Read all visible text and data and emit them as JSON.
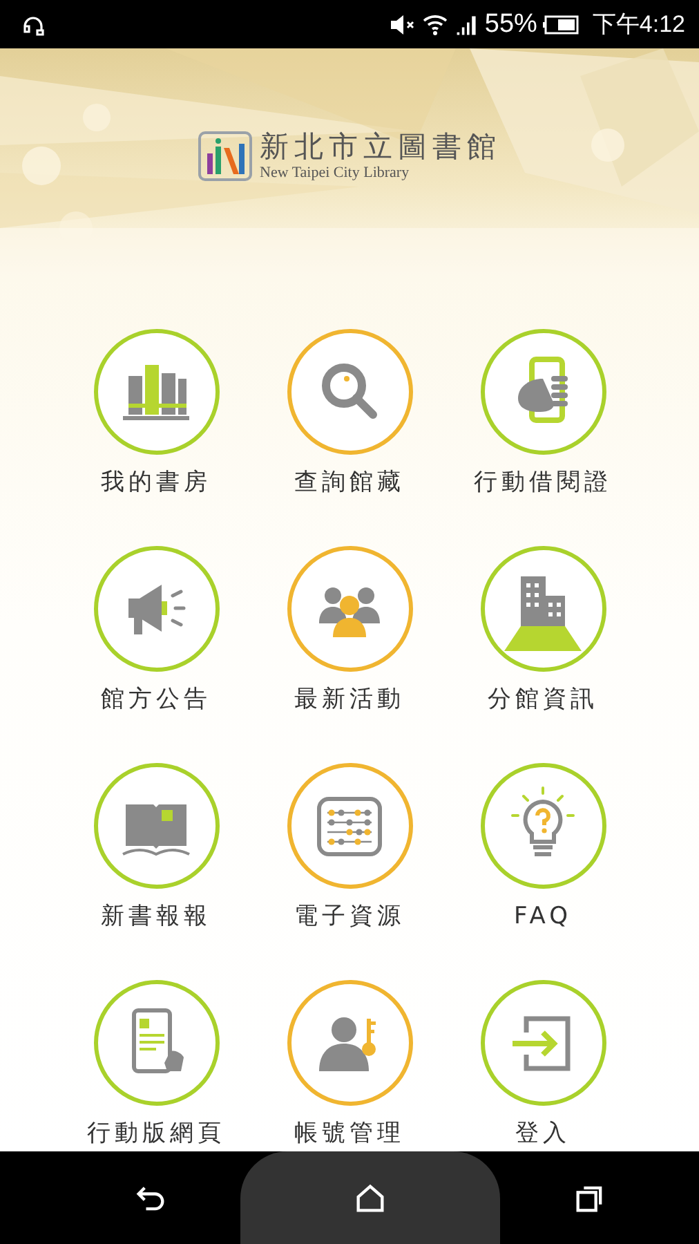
{
  "status_bar": {
    "battery": "55%",
    "time": "下午4:12"
  },
  "header": {
    "title": "新北市立圖書館",
    "subtitle": "New Taipei City Library"
  },
  "menu": [
    {
      "label": "我的書房",
      "kind": "books",
      "color": "#a9d12b"
    },
    {
      "label": "查詢館藏",
      "kind": "search",
      "color": "#f0b530"
    },
    {
      "label": "行動借閱證",
      "kind": "phone",
      "color": "#a9d12b"
    },
    {
      "label": "館方公告",
      "kind": "megaphone",
      "color": "#a9d12b"
    },
    {
      "label": "最新活動",
      "kind": "people",
      "color": "#f0b530"
    },
    {
      "label": "分館資訊",
      "kind": "building",
      "color": "#a9d12b"
    },
    {
      "label": "新書報報",
      "kind": "book",
      "color": "#a9d12b"
    },
    {
      "label": "電子資源",
      "kind": "abacus",
      "color": "#f0b530"
    },
    {
      "label": "FAQ",
      "kind": "bulb",
      "color": "#a9d12b"
    },
    {
      "label": "行動版網頁",
      "kind": "tablet",
      "color": "#a9d12b"
    },
    {
      "label": "帳號管理",
      "kind": "account",
      "color": "#f0b530"
    },
    {
      "label": "登入",
      "kind": "login",
      "color": "#a9d12b"
    }
  ]
}
